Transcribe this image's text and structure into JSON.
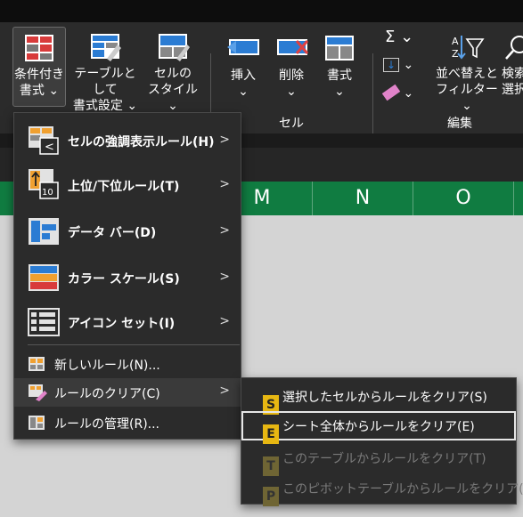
{
  "ribbon": {
    "cond_format": {
      "line1": "条件付き",
      "line2": "書式 ⌄"
    },
    "table_format": {
      "line1": "テーブルとして",
      "line2": "書式設定 ⌄"
    },
    "cell_style": {
      "line1": "セルの",
      "line2": "スタイル ⌄"
    },
    "insert": {
      "line1": "挿入",
      "line2": "⌄"
    },
    "delete": {
      "line1": "削除",
      "line2": "⌄"
    },
    "format": {
      "line1": "書式",
      "line2": "⌄"
    },
    "sort_filter": {
      "line1": "並べ替えと",
      "line2": "フィルター ⌄"
    },
    "find_select": {
      "line1": "検索",
      "line2": "選択"
    },
    "group_cells": "セル",
    "group_edit": "編集",
    "sum_symbol": "Σ ⌄",
    "fill_symbol": "⌄",
    "clear_symbol": "⌄"
  },
  "columns": [
    "M",
    "N",
    "O"
  ],
  "menu": {
    "items": [
      {
        "label": "セルの強調表示ルール(H)",
        "arrow": ">"
      },
      {
        "label": "上位/下位ルール(T)",
        "arrow": ">"
      },
      {
        "label": "データ バー(D)",
        "arrow": ">"
      },
      {
        "label": "カラー スケール(S)",
        "arrow": ">"
      },
      {
        "label": "アイコン セット(I)",
        "arrow": ">"
      },
      {
        "label": "新しいルール(N)..."
      },
      {
        "label": "ルールのクリア(C)",
        "arrow": ">"
      },
      {
        "label": "ルールの管理(R)..."
      }
    ]
  },
  "submenu": {
    "items": [
      {
        "key": "S",
        "label": "選択したセルからルールをクリア(S)"
      },
      {
        "key": "E",
        "label": "シート全体からルールをクリア(E)"
      },
      {
        "key": "T",
        "label": "このテーブルからルールをクリア(T)"
      },
      {
        "key": "P",
        "label": "このピボットテーブルからルールをクリア(P)"
      }
    ]
  },
  "colors": {
    "accent": "#107c41",
    "keytip": "#e7b712"
  }
}
